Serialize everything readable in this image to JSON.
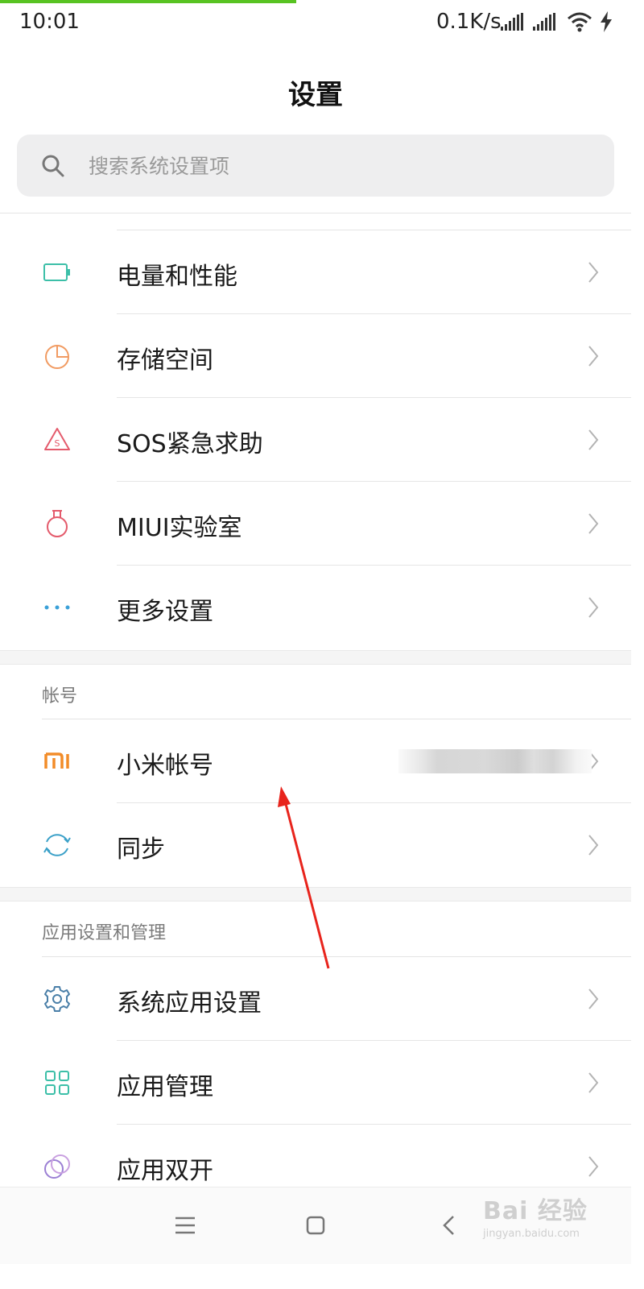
{
  "status_bar": {
    "time": "10:01",
    "network_speed": "0.1K/s",
    "icons": [
      "cell-signal-icon",
      "cell-signal-icon",
      "wifi-icon",
      "charging-icon"
    ],
    "progress_color": "#58c322"
  },
  "header": {
    "title": "设置"
  },
  "search": {
    "placeholder": "搜索系统设置项"
  },
  "groups": {
    "main": {
      "items": [
        {
          "label": "电量和性能",
          "icon": "battery-icon",
          "color": "#3cbfa8"
        },
        {
          "label": "存储空间",
          "icon": "pie-chart-icon",
          "color": "#f19b62"
        },
        {
          "label": "SOS紧急求助",
          "icon": "sos-icon",
          "color": "#e45b6c"
        },
        {
          "label": "MIUI实验室",
          "icon": "flask-icon",
          "color": "#e45b6c"
        },
        {
          "label": "更多设置",
          "icon": "more-dots-icon",
          "color": "#3aa0d8"
        }
      ]
    },
    "account": {
      "title": "帐号",
      "items": [
        {
          "label": "小米帐号",
          "icon": "mi-logo-icon",
          "color": "#f28c28"
        },
        {
          "label": "同步",
          "icon": "sync-icon",
          "color": "#3aa0c8"
        }
      ]
    },
    "apps": {
      "title": "应用设置和管理",
      "items": [
        {
          "label": "系统应用设置",
          "icon": "gear-icon",
          "color": "#4a7fa8"
        },
        {
          "label": "应用管理",
          "icon": "grid-icon",
          "color": "#3cbfa8"
        },
        {
          "label": "应用双开",
          "icon": "dual-circle-icon",
          "color": "#9b7fd4"
        }
      ]
    }
  },
  "nav_bar": {
    "icons": [
      "menu-icon",
      "home-icon",
      "back-icon"
    ]
  },
  "watermark": {
    "line1": "Bai 经验",
    "line2": "jingyan.baidu.com"
  },
  "annotation": {
    "color": "#e8241c"
  }
}
